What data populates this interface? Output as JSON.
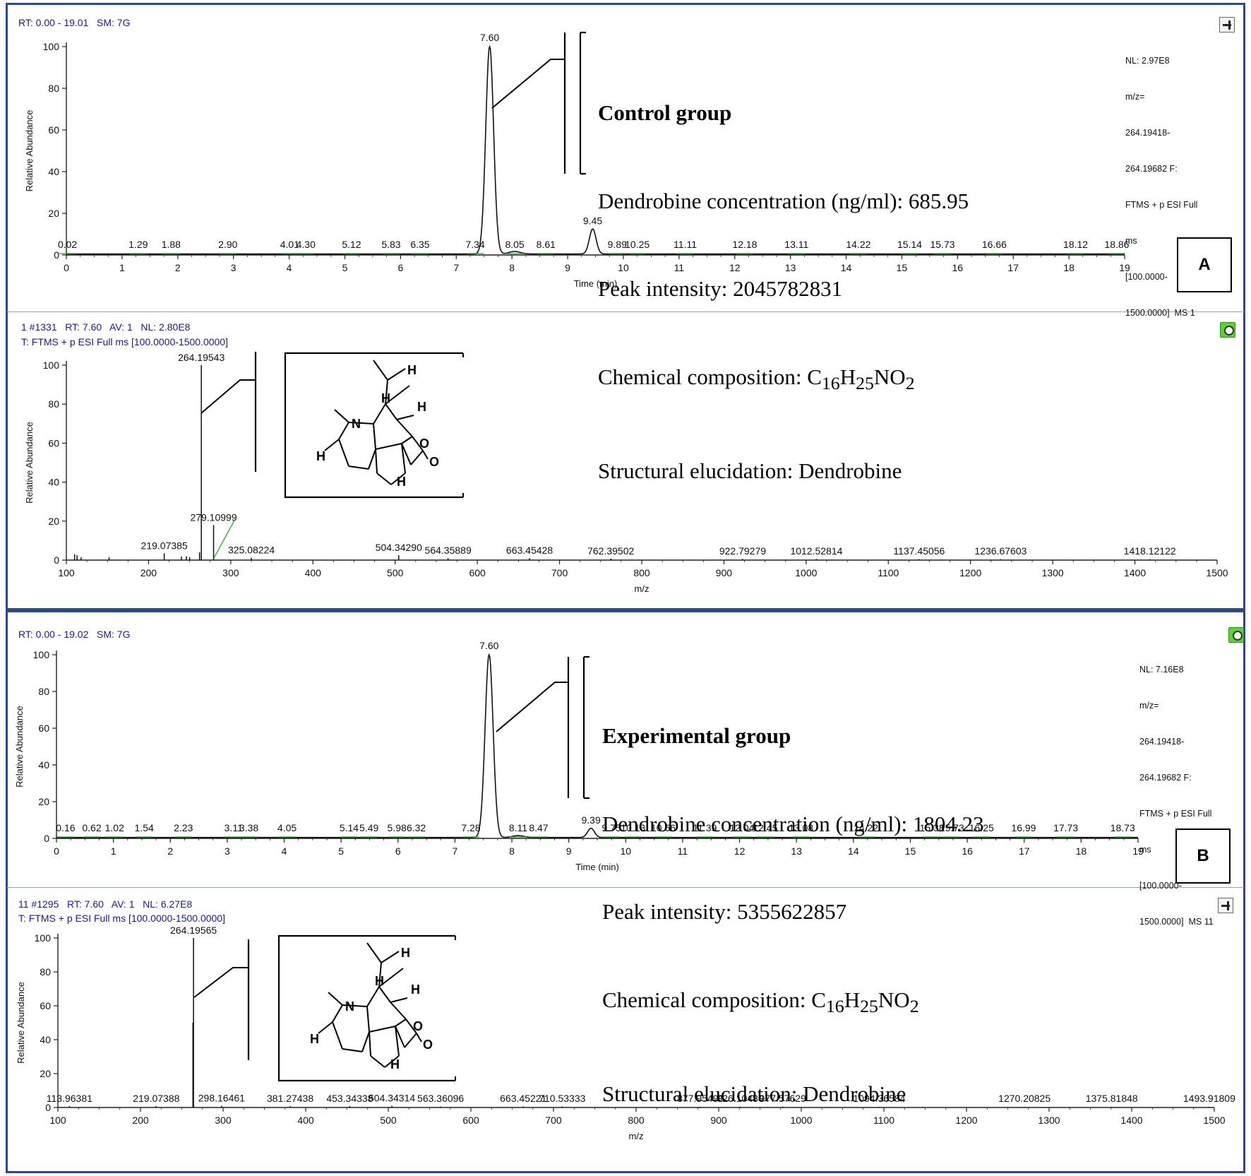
{
  "figure": {
    "panel_a_label": "A",
    "panel_b_label": "B",
    "colors": {
      "frame": "#2b4a8a",
      "header_text": "#1a1a8c",
      "trace": "#000000",
      "peak_marker": "#22aa22",
      "button_green": "#5cd42e"
    }
  },
  "panels": [
    {
      "id": "a-chrom",
      "header": "RT: 0.00 - 19.01   SM: 7G",
      "header2": "",
      "nl": [
        "NL: 2.97E8",
        "m/z=",
        "264.19418-",
        "264.19682 F:",
        "FTMS + p ESI Full",
        "ms",
        "[100.0000-",
        "1500.0000]  MS 1"
      ],
      "icon": "pin-icon",
      "info": {
        "title": "Control group",
        "line1": "Dendrobine concentration (ng/ml): 685.95",
        "line2": "Peak intensity: 2045782831",
        "line3_prefix": "Chemical composition: ",
        "line4": "Structural elucidation: Dendrobine"
      }
    },
    {
      "id": "a-ms",
      "header": "1 #1331   RT: 7.60   AV: 1   NL: 2.80E8",
      "header2": "T: FTMS + p ESI Full ms [100.0000-1500.0000]",
      "nl": [],
      "icon": "lock-icon"
    },
    {
      "id": "b-chrom",
      "header": "RT: 0.00 - 19.02   SM: 7G",
      "header2": "",
      "nl": [
        "NL: 7.16E8",
        "m/z=",
        "264.19418-",
        "264.19682 F:",
        "FTMS + p ESI Full",
        "ms",
        "[100.0000-",
        "1500.0000]  MS 11"
      ],
      "icon": "lock-icon",
      "info": {
        "title": "Experimental group",
        "line1": "Dendrobine concentration (ng/ml): 1804.23",
        "line2": "Peak intensity: 5355622857",
        "line3_prefix": "Chemical composition: ",
        "line4": "Structural elucidation: Dendrobine"
      }
    },
    {
      "id": "b-ms",
      "header": "11 #1295   RT: 7.60   AV: 1   NL: 6.27E8",
      "header2": "T: FTMS + p ESI Full ms [100.0000-1500.0000]",
      "nl": [],
      "icon": "pin-icon"
    }
  ],
  "formula": {
    "c": "C",
    "c_sub": "16",
    "h": "H",
    "h_sub": "25",
    "rest": "NO",
    "o_sub": "2"
  },
  "structure": {
    "atom_labels": [
      "N",
      "H",
      "H",
      "H",
      "O",
      "O",
      "H",
      "H"
    ]
  },
  "chart_data": [
    {
      "type": "line",
      "title": "",
      "xlabel": "Time (min)",
      "ylabel": "Relative Abundance",
      "xlim": [
        0,
        19
      ],
      "ylim": [
        0,
        100
      ],
      "xticks": [
        0,
        1,
        2,
        3,
        4,
        5,
        6,
        7,
        8,
        9,
        10,
        11,
        12,
        13,
        14,
        15,
        16,
        17,
        18,
        19
      ],
      "yticks": [
        0,
        20,
        40,
        60,
        80,
        100
      ],
      "peaks": [
        {
          "x": 7.6,
          "y": 100,
          "width": 0.07
        },
        {
          "x": 9.45,
          "y": 12,
          "width": 0.06
        },
        {
          "x": 8.05,
          "y": 1.2,
          "width": 0.1
        }
      ],
      "peak_labels": [
        {
          "x": 0.02,
          "label": "0.02"
        },
        {
          "x": 1.29,
          "label": "1.29"
        },
        {
          "x": 1.88,
          "label": "1.88"
        },
        {
          "x": 2.9,
          "label": "2.90"
        },
        {
          "x": 4.01,
          "label": "4.01"
        },
        {
          "x": 4.3,
          "label": "4.30"
        },
        {
          "x": 5.12,
          "label": "5.12"
        },
        {
          "x": 5.83,
          "label": "5.83"
        },
        {
          "x": 6.35,
          "label": "6.35"
        },
        {
          "x": 7.34,
          "label": "7.34"
        },
        {
          "x": 7.6,
          "y": 100,
          "label": "7.60"
        },
        {
          "x": 8.05,
          "label": "8.05"
        },
        {
          "x": 8.61,
          "label": "8.61"
        },
        {
          "x": 9.45,
          "y": 12,
          "label": "9.45"
        },
        {
          "x": 9.89,
          "label": "9.89"
        },
        {
          "x": 10.25,
          "label": "10.25"
        },
        {
          "x": 11.11,
          "label": "11.11"
        },
        {
          "x": 12.18,
          "label": "12.18"
        },
        {
          "x": 13.11,
          "label": "13.11"
        },
        {
          "x": 14.22,
          "label": "14.22"
        },
        {
          "x": 15.14,
          "label": "15.14"
        },
        {
          "x": 15.73,
          "label": "15.73"
        },
        {
          "x": 16.66,
          "label": "16.66"
        },
        {
          "x": 18.12,
          "label": "18.12"
        },
        {
          "x": 18.86,
          "label": "18.86"
        }
      ]
    },
    {
      "type": "bar",
      "title": "",
      "xlabel": "m/z",
      "ylabel": "Relative Abundance",
      "xlim": [
        100,
        1500
      ],
      "ylim": [
        0,
        100
      ],
      "xticks": [
        100,
        200,
        300,
        400,
        500,
        600,
        700,
        800,
        900,
        1000,
        1100,
        1200,
        1300,
        1400,
        1500
      ],
      "yticks": [
        0,
        20,
        40,
        60,
        80,
        100
      ],
      "sticks": [
        {
          "x": 264.19543,
          "y": 100
        },
        {
          "x": 219.07385,
          "y": 3.5
        },
        {
          "x": 279.10999,
          "y": 18
        },
        {
          "x": 325.08224,
          "y": 1.2
        },
        {
          "x": 504.3429,
          "y": 2.5
        },
        {
          "x": 564.35889,
          "y": 1
        },
        {
          "x": 663.45428,
          "y": 1
        },
        {
          "x": 762.39502,
          "y": 0.8
        },
        {
          "x": 922.79279,
          "y": 0.6
        },
        {
          "x": 1012.52814,
          "y": 0.6
        },
        {
          "x": 1137.45056,
          "y": 0.5
        },
        {
          "x": 1236.67603,
          "y": 0.5
        },
        {
          "x": 1418.12122,
          "y": 0.4
        },
        {
          "x": 110,
          "y": 3
        },
        {
          "x": 113,
          "y": 2.5
        },
        {
          "x": 118,
          "y": 1.5
        },
        {
          "x": 152,
          "y": 1.5
        },
        {
          "x": 240,
          "y": 1.8
        },
        {
          "x": 246,
          "y": 2
        },
        {
          "x": 250,
          "y": 1.5
        },
        {
          "x": 262,
          "y": 4
        }
      ],
      "peak_labels": [
        {
          "x": 264.19543,
          "y": 100,
          "label": "264.19543"
        },
        {
          "x": 219.07385,
          "y": 3.5,
          "label": "219.07385"
        },
        {
          "x": 279.10999,
          "y": 18,
          "label": "279.10999"
        },
        {
          "x": 325.08224,
          "y": 1.2,
          "label": "325.08224"
        },
        {
          "x": 504.3429,
          "y": 2.5,
          "label": "504.34290"
        },
        {
          "x": 564.35889,
          "y": 1,
          "label": "564.35889"
        },
        {
          "x": 663.45428,
          "y": 1,
          "label": "663.45428"
        },
        {
          "x": 762.39502,
          "y": 0.8,
          "label": "762.39502"
        },
        {
          "x": 922.79279,
          "y": 0.6,
          "label": "922.79279"
        },
        {
          "x": 1012.52814,
          "y": 0.6,
          "label": "1012.52814"
        },
        {
          "x": 1137.45056,
          "y": 0.5,
          "label": "1137.45056"
        },
        {
          "x": 1236.67603,
          "y": 0.5,
          "label": "1236.67603"
        },
        {
          "x": 1418.12122,
          "y": 0.4,
          "label": "1418.12122"
        }
      ]
    },
    {
      "type": "line",
      "title": "",
      "xlabel": "Time (min)",
      "ylabel": "Relative Abundance",
      "xlim": [
        0,
        19
      ],
      "ylim": [
        0,
        100
      ],
      "xticks": [
        0,
        1,
        2,
        3,
        4,
        5,
        6,
        7,
        8,
        9,
        10,
        11,
        12,
        13,
        14,
        15,
        16,
        17,
        18,
        19
      ],
      "yticks": [
        0,
        20,
        40,
        60,
        80,
        100
      ],
      "peaks": [
        {
          "x": 7.6,
          "y": 100,
          "width": 0.07
        },
        {
          "x": 9.39,
          "y": 5,
          "width": 0.06
        },
        {
          "x": 8.11,
          "y": 1,
          "width": 0.1
        }
      ],
      "peak_labels": [
        {
          "x": 0.16,
          "label": "0.16"
        },
        {
          "x": 0.62,
          "label": "0.62"
        },
        {
          "x": 1.02,
          "label": "1.02"
        },
        {
          "x": 1.54,
          "label": "1.54"
        },
        {
          "x": 2.23,
          "label": "2.23"
        },
        {
          "x": 3.11,
          "label": "3.11"
        },
        {
          "x": 3.38,
          "label": "3.38"
        },
        {
          "x": 4.05,
          "label": "4.05"
        },
        {
          "x": 5.14,
          "label": "5.14"
        },
        {
          "x": 5.49,
          "label": "5.49"
        },
        {
          "x": 5.98,
          "label": "5.98"
        },
        {
          "x": 6.32,
          "label": "6.32"
        },
        {
          "x": 7.28,
          "label": "7.28"
        },
        {
          "x": 7.6,
          "y": 100,
          "label": "7.60"
        },
        {
          "x": 8.11,
          "label": "8.11"
        },
        {
          "x": 8.47,
          "label": "8.47"
        },
        {
          "x": 9.39,
          "y": 5,
          "label": "9.39"
        },
        {
          "x": 9.75,
          "label": "9.75"
        },
        {
          "x": 10.13,
          "label": "10.13"
        },
        {
          "x": 10.66,
          "label": "10.66"
        },
        {
          "x": 11.39,
          "label": "11.39"
        },
        {
          "x": 12.04,
          "label": "12.04"
        },
        {
          "x": 12.45,
          "label": "12.45"
        },
        {
          "x": 13.08,
          "label": "13.08"
        },
        {
          "x": 14.22,
          "label": "14.22"
        },
        {
          "x": 15.38,
          "label": "15.38"
        },
        {
          "x": 15.73,
          "label": "15.73"
        },
        {
          "x": 16.25,
          "label": "16.25"
        },
        {
          "x": 16.99,
          "label": "16.99"
        },
        {
          "x": 17.73,
          "label": "17.73"
        },
        {
          "x": 18.73,
          "label": "18.73"
        }
      ]
    },
    {
      "type": "bar",
      "title": "",
      "xlabel": "m/z",
      "ylabel": "Relative Abundance",
      "xlim": [
        100,
        1500
      ],
      "ylim": [
        0,
        100
      ],
      "xticks": [
        100,
        200,
        300,
        400,
        500,
        600,
        700,
        800,
        900,
        1000,
        1100,
        1200,
        1300,
        1400,
        1500
      ],
      "yticks": [
        0,
        20,
        40,
        60,
        80,
        100
      ],
      "sticks": [
        {
          "x": 264.19565,
          "y": 100
        },
        {
          "x": 263.5,
          "y": 50
        },
        {
          "x": 113.96381,
          "y": 0.8
        },
        {
          "x": 219.07388,
          "y": 0.8
        },
        {
          "x": 298.16461,
          "y": 1
        },
        {
          "x": 381.27438,
          "y": 0.8
        },
        {
          "x": 453.34338,
          "y": 0.8
        },
        {
          "x": 504.34314,
          "y": 1
        },
        {
          "x": 563.36096,
          "y": 0.6
        },
        {
          "x": 663.45221,
          "y": 0.6
        },
        {
          "x": 710.53333,
          "y": 0.6
        },
        {
          "x": 877.9549,
          "y": 0.5
        },
        {
          "x": 926.1048,
          "y": 0.5
        },
        {
          "x": 977.57629,
          "y": 0.5
        },
        {
          "x": 1094.36584,
          "y": 0.4
        },
        {
          "x": 1270.20825,
          "y": 0.4
        },
        {
          "x": 1375.81848,
          "y": 0.4
        },
        {
          "x": 1493.91809,
          "y": 0.4
        }
      ],
      "peak_labels": [
        {
          "x": 264.19565,
          "y": 100,
          "label": "264.19565"
        },
        {
          "x": 113.96381,
          "y": 0.8,
          "label": "113.96381"
        },
        {
          "x": 219.07388,
          "y": 0.8,
          "label": "219.07388"
        },
        {
          "x": 298.16461,
          "y": 1,
          "label": "298.16461"
        },
        {
          "x": 381.27438,
          "y": 0.8,
          "label": "381.27438"
        },
        {
          "x": 453.34338,
          "y": 0.8,
          "label": "453.34338"
        },
        {
          "x": 504.34314,
          "y": 1,
          "label": "504.34314"
        },
        {
          "x": 563.36096,
          "y": 0.6,
          "label": "563.36096"
        },
        {
          "x": 663.45221,
          "y": 0.6,
          "label": "663.45221"
        },
        {
          "x": 710.53333,
          "y": 0.6,
          "label": "710.53333"
        },
        {
          "x": 877.9549,
          "y": 0.5,
          "label": "877.95490"
        },
        {
          "x": 926.1048,
          "y": 0.5,
          "label": "926.10480"
        },
        {
          "x": 977.57629,
          "y": 0.5,
          "label": "977.57629"
        },
        {
          "x": 1094.36584,
          "y": 0.4,
          "label": "1094.36584"
        },
        {
          "x": 1270.20825,
          "y": 0.4,
          "label": "1270.20825"
        },
        {
          "x": 1375.81848,
          "y": 0.4,
          "label": "1375.81848"
        },
        {
          "x": 1493.91809,
          "y": 0.4,
          "label": "1493.91809"
        }
      ]
    }
  ]
}
